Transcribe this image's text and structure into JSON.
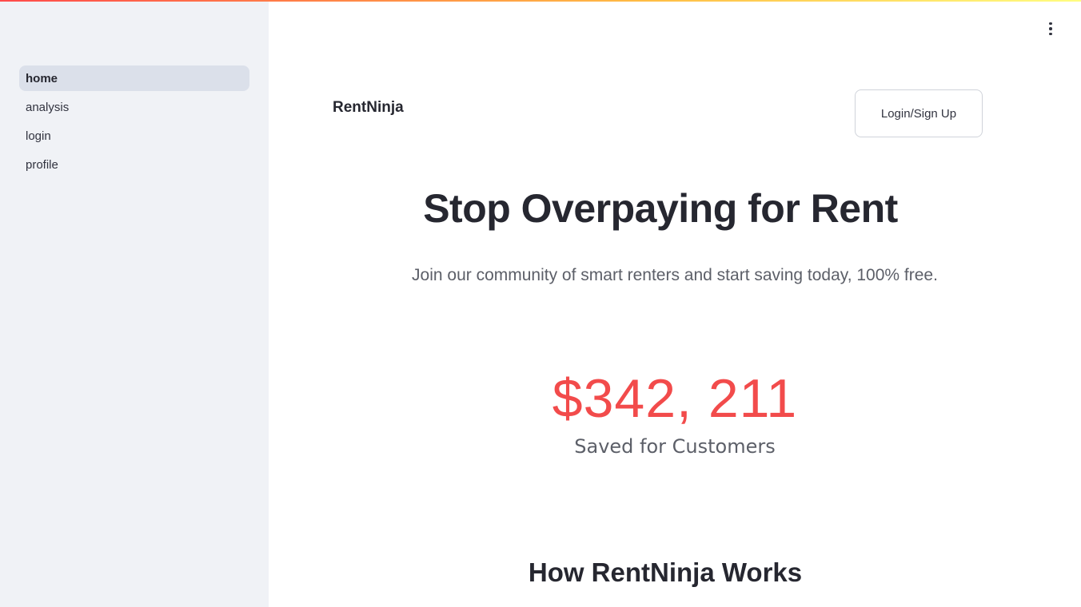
{
  "sidebar": {
    "items": [
      {
        "label": "home",
        "active": true
      },
      {
        "label": "analysis"
      },
      {
        "label": "login"
      },
      {
        "label": "profile"
      }
    ]
  },
  "header": {
    "brand": "RentNinja",
    "login_label": "Login/Sign Up",
    "menu_icon": "vertical-dots-icon"
  },
  "hero": {
    "title": "Stop Overpaying for Rent",
    "subtitle": "Join our community of smart renters and start saving today, 100% free."
  },
  "stats": {
    "value": "$342, 211",
    "label": "Saved for Customers"
  },
  "sections": {
    "how_title": "How RentNinja Works"
  },
  "colors": {
    "accent": "#ff4b4b",
    "sidebar_bg": "#f0f2f6",
    "active_item_bg": "#dbe0ea",
    "stat_color": "#f24b4b"
  }
}
